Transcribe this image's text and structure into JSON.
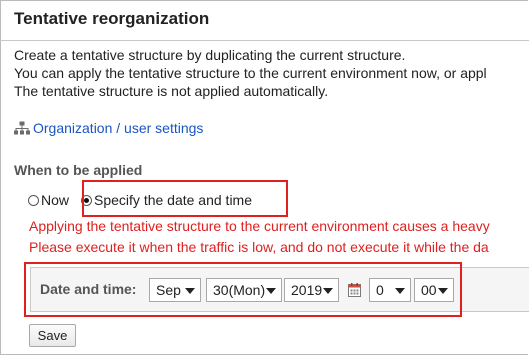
{
  "page": {
    "title": "Tentative reorganization",
    "description": [
      "Create a tentative structure by duplicating the current structure.",
      "You can apply the tentative structure to the current environment now, or appl",
      "The tentative structure is not applied automatically."
    ],
    "org_link": "Organization / user settings"
  },
  "when_applied": {
    "heading": "When to be applied",
    "options": [
      {
        "label": "Now",
        "checked": false
      },
      {
        "label": "Specify the date and time",
        "checked": true
      }
    ],
    "warning": [
      "Applying the tentative structure to the current environment causes a heavy",
      "Please execute it when the traffic is low, and do not execute it while the da"
    ]
  },
  "datetime": {
    "label": "Date and time:",
    "month": "Sep",
    "day": "30(Mon)",
    "year": "2019",
    "hour": "0",
    "minute": "00"
  },
  "actions": {
    "save": "Save"
  },
  "colors": {
    "link": "#1a55c4",
    "warning": "#e02020",
    "highlight": "#e02020"
  },
  "icons": {
    "org": "org-chart-icon",
    "calendar": "calendar-icon"
  }
}
